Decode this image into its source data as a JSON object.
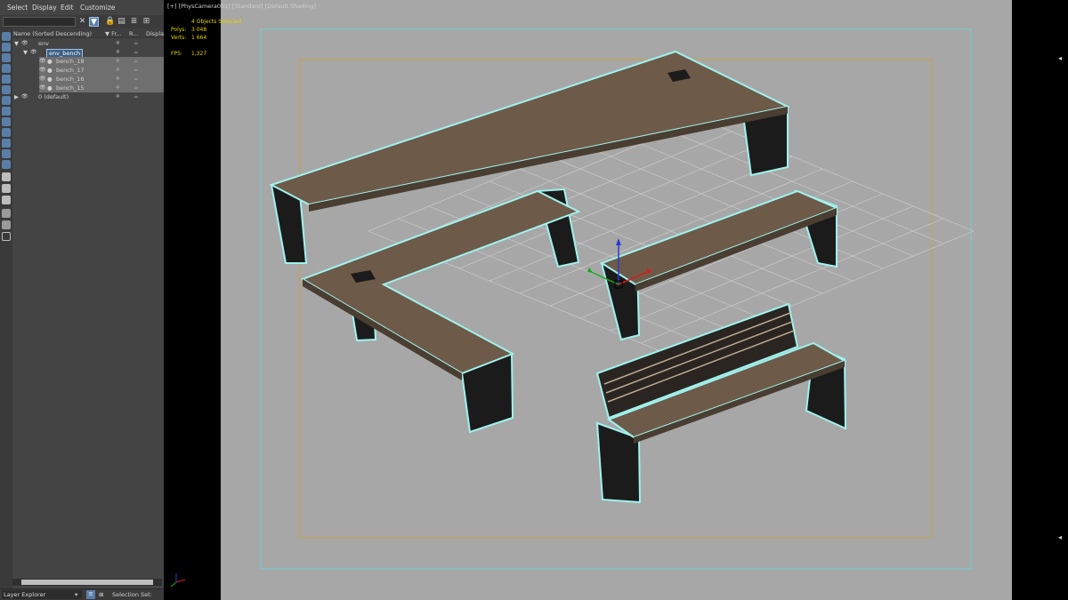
{
  "menu": {
    "select": "Select",
    "display": "Display",
    "edit": "Edit",
    "customize": "Customize"
  },
  "tree": {
    "columns": {
      "name": "Name (Sorted Descending)",
      "frozen": "▼ Fr...",
      "render": "R...",
      "display": "Displa"
    },
    "rows": [
      {
        "label": "env"
      },
      {
        "label": "env_bench"
      },
      {
        "label": "bench_18"
      },
      {
        "label": "bench_17"
      },
      {
        "label": "bench_16"
      },
      {
        "label": "bench_15"
      },
      {
        "label": "0 (default)"
      }
    ]
  },
  "bottombar": {
    "explorer_name": "Layer Explorer",
    "selection_set_label": "Selection Set:"
  },
  "viewport": {
    "label": "[+] [PhysCamera001] [Standard] [Default Shading]",
    "stats": {
      "selection": "4 Objects Selected",
      "polys_label": "Polys:",
      "polys_value": "3 048",
      "verts_label": "Verts:",
      "verts_value": "1 664",
      "fps_label": "FPS:",
      "fps_value": "1,327"
    }
  },
  "colors": {
    "panel_bg": "#444444",
    "viewport_bg": "#a7a7a7",
    "selection_outline": "#9ff2ee",
    "wood": "#6e5a48",
    "metal": "#1a1a1a",
    "safe_frame_cyan": "#6fd0d6",
    "safe_frame_orange": "#c8a142",
    "stats_text": "#e6d200",
    "accent_blue": "#5a7ea8"
  }
}
